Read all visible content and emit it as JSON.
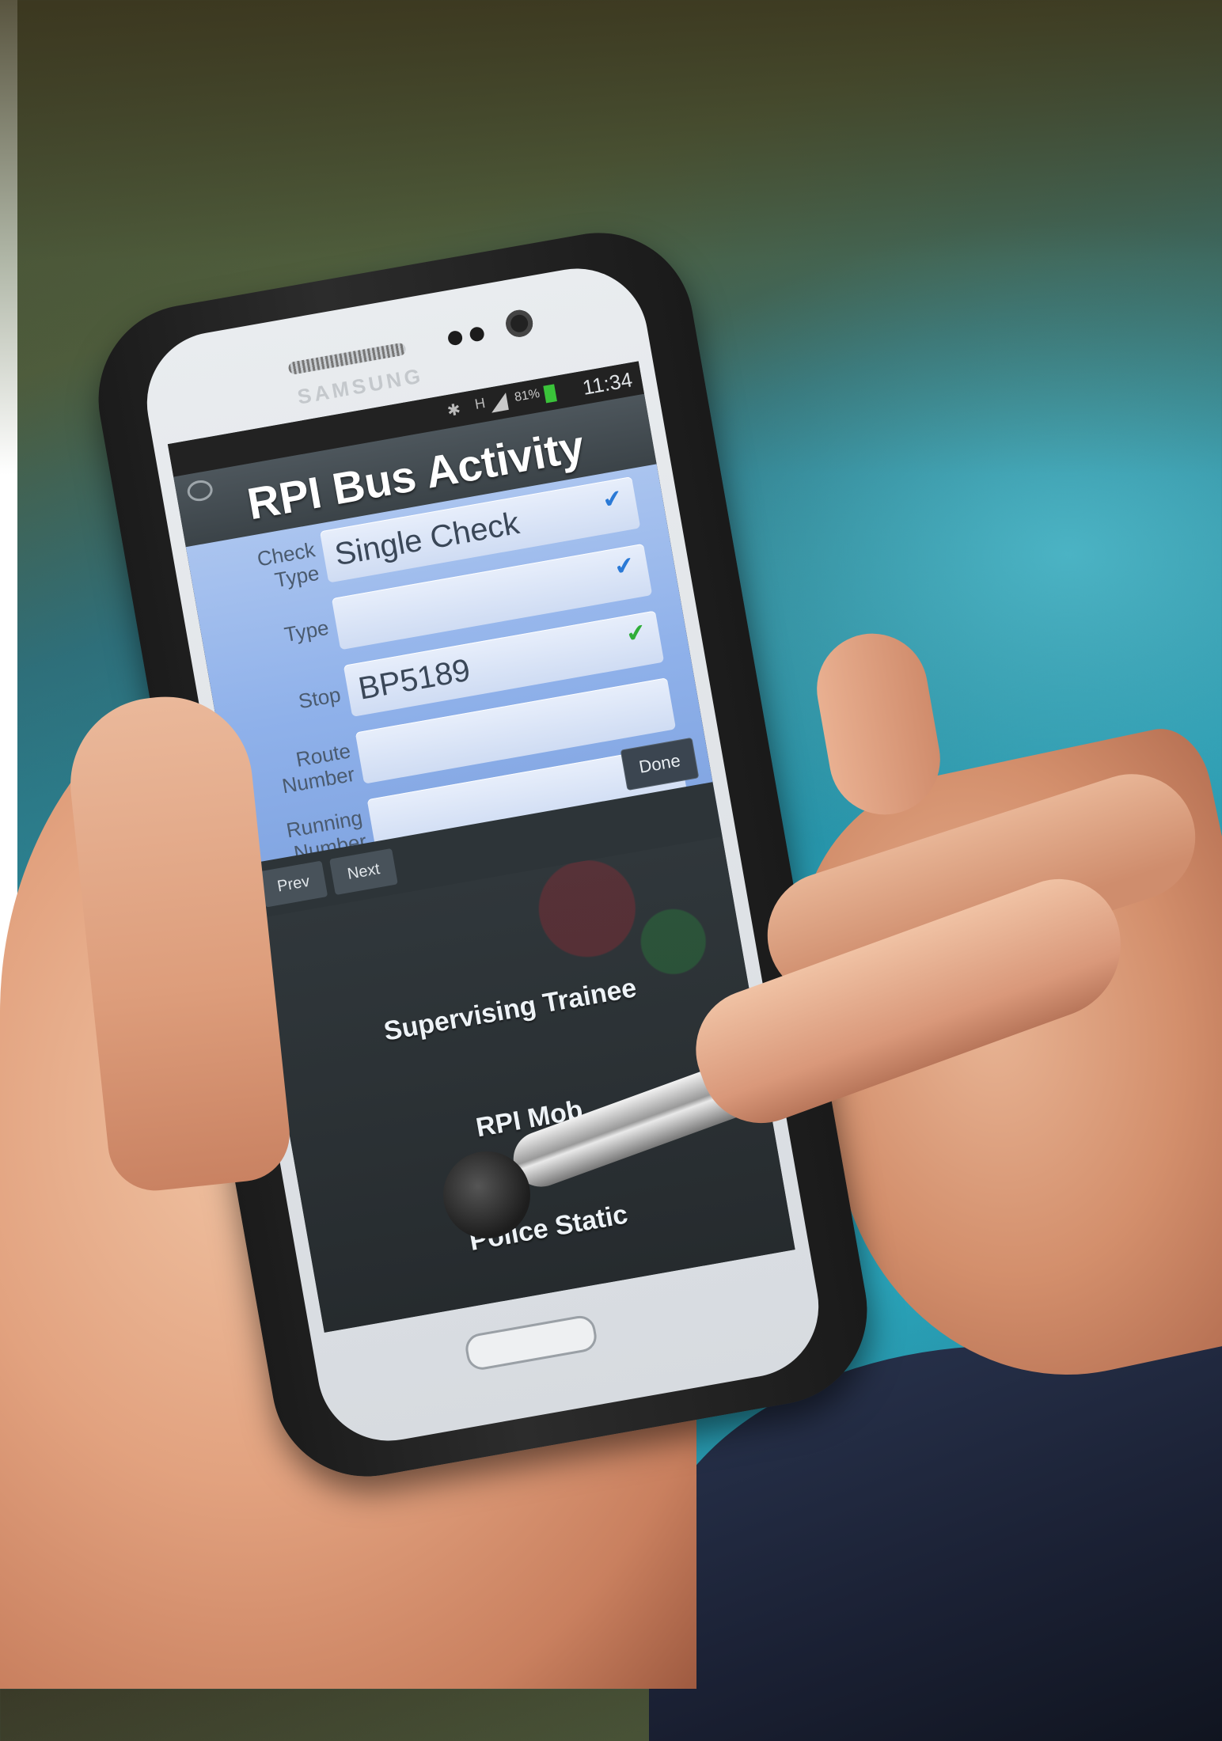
{
  "phone": {
    "brand": "SAMSUNG",
    "status_bar": {
      "bluetooth_icon": "bluetooth-icon",
      "network_label": "H",
      "battery_percent": "81%",
      "time": "11:34"
    }
  },
  "app": {
    "title": "RPI Bus Activity",
    "fields": [
      {
        "label_line1": "Check",
        "label_line2": "Type",
        "value": "Single Check",
        "status_icon": "check-icon",
        "status_color": "#2a79d6"
      },
      {
        "label_line1": "Type",
        "label_line2": "",
        "value": "",
        "status_icon": "check-icon",
        "status_color": "#2a79d6"
      },
      {
        "label_line1": "Stop",
        "label_line2": "",
        "value": "BP5189",
        "status_icon": "check-icon",
        "status_color": "#2fae39"
      },
      {
        "label_line1": "Route",
        "label_line2": "Number",
        "value": "",
        "status_icon": "",
        "status_color": ""
      },
      {
        "label_line1": "Running",
        "label_line2": "Number",
        "value": "",
        "status_icon": "",
        "status_color": ""
      }
    ],
    "buttons": {
      "done": "Done",
      "prev": "Prev",
      "next": "Next"
    },
    "menu_items": [
      "Supervising Trainee",
      "RPI Mob",
      "Police Static"
    ]
  }
}
